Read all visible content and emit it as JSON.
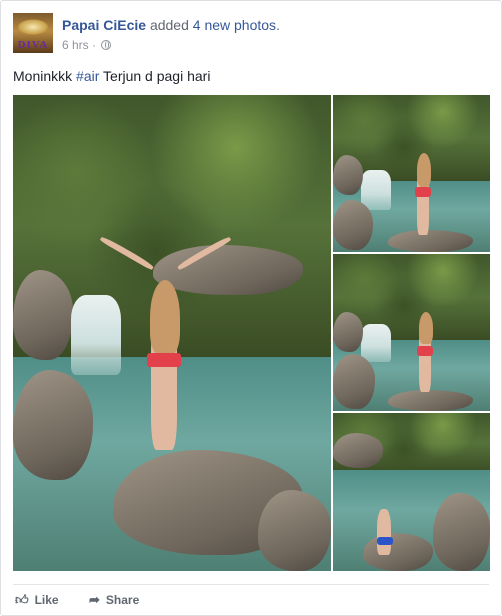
{
  "post": {
    "author": "Papai CiEcie",
    "action_prefix": "added",
    "action_link": "4 new photos",
    "action_suffix": ".",
    "timestamp": "6 hrs",
    "separator": "·",
    "privacy_icon": "globe-icon",
    "caption_start": "Moninkkk ",
    "hashtag": "#air",
    "caption_end": " Terjun d pagi hari",
    "avatar_text": "DIVA"
  },
  "actions": {
    "like_icon": "thumbs-up-icon",
    "like_label": "Like",
    "share_icon": "share-arrow-icon",
    "share_label": "Share"
  },
  "colors": {
    "link": "#365899",
    "meta": "#90949c",
    "border": "#dddfe2"
  }
}
